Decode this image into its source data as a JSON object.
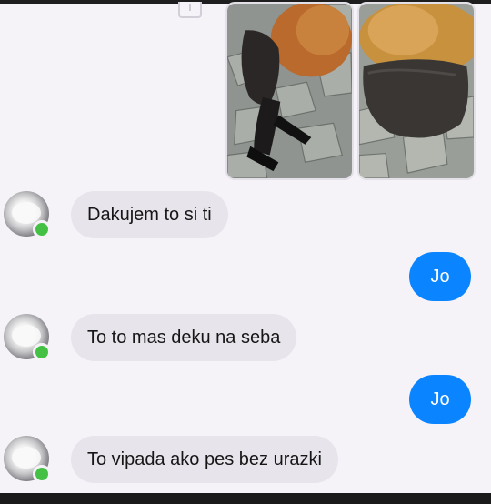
{
  "conversation": {
    "messages": [
      {
        "direction": "incoming",
        "text": "Dakujem to si ti"
      },
      {
        "direction": "outgoing",
        "text": "Jo"
      },
      {
        "direction": "incoming",
        "text": "To to mas deku na seba"
      },
      {
        "direction": "outgoing",
        "text": "Jo"
      },
      {
        "direction": "incoming",
        "text": "To vipada ako pes bez urazki"
      }
    ]
  },
  "icons": {
    "share": "share-icon",
    "online": "online-status-icon"
  },
  "colors": {
    "outgoing_bubble": "#0b84ff",
    "incoming_bubble": "#e8e4ec",
    "online_dot": "#44c144",
    "background": "#f6f3f8"
  }
}
